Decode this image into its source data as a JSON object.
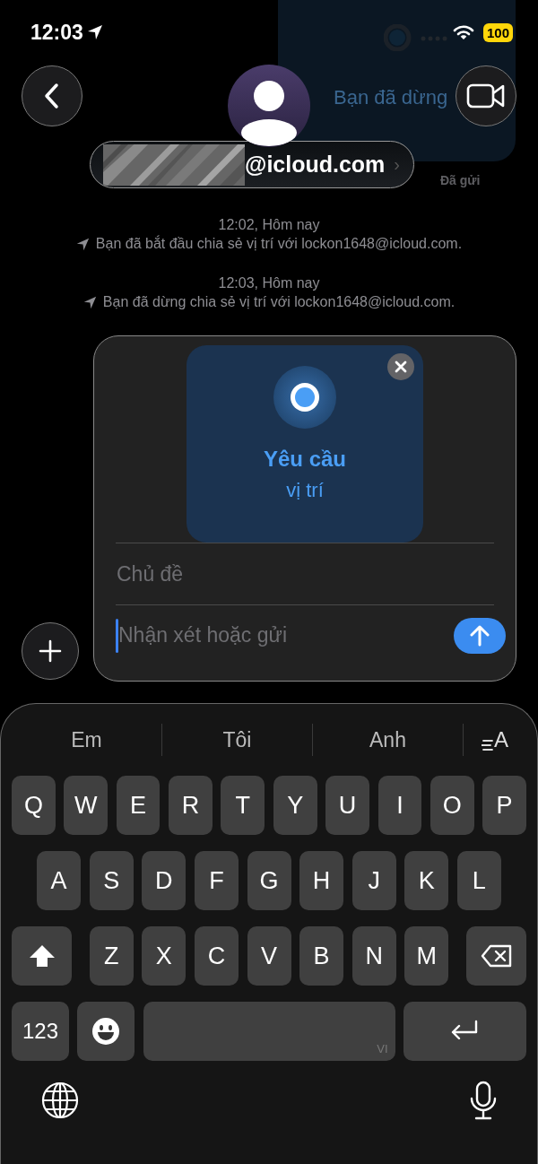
{
  "status_bar": {
    "time": "12:03",
    "battery": "100"
  },
  "background_bubble": {
    "text": "Bạn đã dừng",
    "delivery": "Đã gửi"
  },
  "header": {
    "contact": "@icloud.com",
    "chevron": "›"
  },
  "events": [
    {
      "time": "12:02, Hôm nay",
      "text": "Bạn đã bắt đầu chia sẻ vị trí với lockon1648@icloud.com."
    },
    {
      "time": "12:03, Hôm nay",
      "text": "Bạn đã dừng chia sẻ vị trí với lockon1648@icloud.com."
    }
  ],
  "compose": {
    "card_title": "Yêu cầu",
    "card_subtitle": "vị trí",
    "subject_placeholder": "Chủ đề",
    "message_placeholder": "Nhận xét hoặc gửi"
  },
  "keyboard": {
    "suggestions": [
      "Em",
      "Tôi",
      "Anh"
    ],
    "text_size_label": "A",
    "rows": [
      [
        "Q",
        "W",
        "E",
        "R",
        "T",
        "Y",
        "U",
        "I",
        "O",
        "P"
      ],
      [
        "A",
        "S",
        "D",
        "F",
        "G",
        "H",
        "J",
        "K",
        "L"
      ],
      [
        "Z",
        "X",
        "C",
        "V",
        "B",
        "N",
        "M"
      ]
    ],
    "numbers_key": "123",
    "space_language": "VI"
  }
}
